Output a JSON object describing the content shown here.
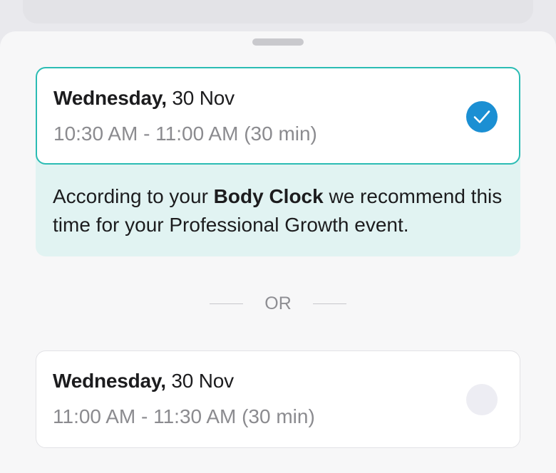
{
  "recommended_slot": {
    "weekday": "Wednesday,",
    "date": " 30 Nov",
    "time": "10:30 AM - 11:00 AM (30 min)",
    "selected": true
  },
  "recommendation": {
    "before": "According to your ",
    "highlight": "Body Clock",
    "after": " we recommend this time for your Professional Growth event."
  },
  "divider": {
    "label": "OR"
  },
  "alternative_slot": {
    "weekday": "Wednesday,",
    "date": " 30 Nov",
    "time": "11:00 AM - 11:30 AM (30 min)",
    "selected": false
  },
  "colors": {
    "accent_teal": "#2bbcb4",
    "check_blue": "#1b8fd3",
    "recommend_bg": "#e1f3f2"
  }
}
